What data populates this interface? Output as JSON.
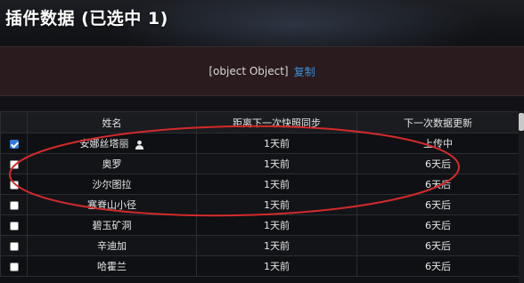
{
  "header": {
    "title": "插件数据 (已选中 1)"
  },
  "info": {
    "text": "[object Object]",
    "copy_label": "复制"
  },
  "table": {
    "headers": [
      "姓名",
      "距离下一次快照同步",
      "下一次数据更新"
    ],
    "rows": [
      {
        "checked": true,
        "name": "安娜丝塔丽",
        "has_user_icon": true,
        "sync": "1天前",
        "update": "上传中"
      },
      {
        "checked": false,
        "name": "奥罗",
        "has_user_icon": false,
        "sync": "1天前",
        "update": "6天后"
      },
      {
        "checked": false,
        "name": "沙尔图拉",
        "has_user_icon": false,
        "sync": "1天前",
        "update": "6天后"
      },
      {
        "checked": false,
        "name": "塞脊山小径",
        "has_user_icon": false,
        "sync": "1天前",
        "update": "6天后"
      },
      {
        "checked": false,
        "name": "碧玉矿洞",
        "has_user_icon": false,
        "sync": "1天前",
        "update": "6天后"
      },
      {
        "checked": false,
        "name": "辛迪加",
        "has_user_icon": false,
        "sync": "1天前",
        "update": "6天后"
      },
      {
        "checked": false,
        "name": "哈霍兰",
        "has_user_icon": false,
        "sync": "1天前",
        "update": "6天后"
      }
    ]
  },
  "colors": {
    "accent": "#3c8fd8",
    "annotation": "#d42a2a",
    "info_bg": "#2a1b1e"
  },
  "icons": {
    "person": "user-icon",
    "check": "checkbox"
  }
}
